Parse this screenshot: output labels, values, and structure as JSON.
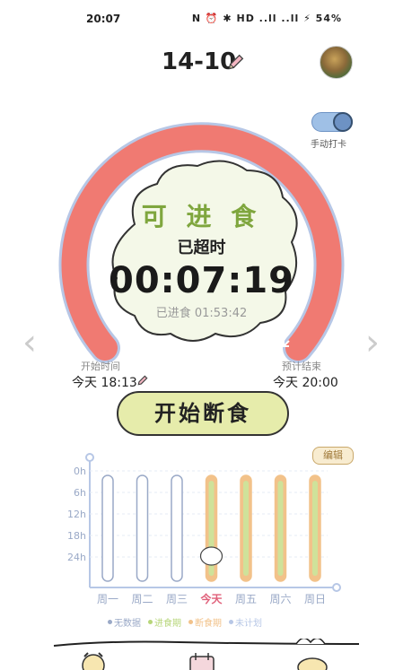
{
  "status_bar": {
    "time": "20:07",
    "icons_text": "N ⏰ ✱ HD ..ll ..ll ⚡ 54%"
  },
  "header": {
    "date": "14-10"
  },
  "toggle": {
    "label": "手动打卡",
    "on": true
  },
  "ring": {
    "status": "可 进 食",
    "overtime_label": "已超时",
    "timer": "00:07:19",
    "eaten": "已进食 01:53:42",
    "colors": {
      "ring": "#f07a72",
      "track": "#b7c7e6",
      "blob": "#f4f8e8"
    }
  },
  "times": {
    "start_label": "开始时间",
    "start_value": "今天 18:13",
    "end_label": "预计结束",
    "end_value": "今天 20:00"
  },
  "action": {
    "start_button": "开始断食"
  },
  "chart": {
    "edit_label": "编辑"
  },
  "chart_data": {
    "type": "bar",
    "y_ticks": [
      "0h",
      "6h",
      "12h",
      "18h",
      "24h"
    ],
    "categories": [
      "周一",
      "周二",
      "周三",
      "今天",
      "周五",
      "周六",
      "周日"
    ],
    "highlight_category": "今天",
    "bar_states": [
      "无数据",
      "无数据",
      "无数据",
      "计划",
      "计划",
      "计划",
      "计划"
    ]
  },
  "legend": [
    {
      "label": "无数据",
      "color": "#9aa9c7"
    },
    {
      "label": "进食期",
      "color": "#b7d67a"
    },
    {
      "label": "断食期",
      "color": "#f2c28a"
    },
    {
      "label": "未计划",
      "color": "#b7c7e6"
    }
  ]
}
